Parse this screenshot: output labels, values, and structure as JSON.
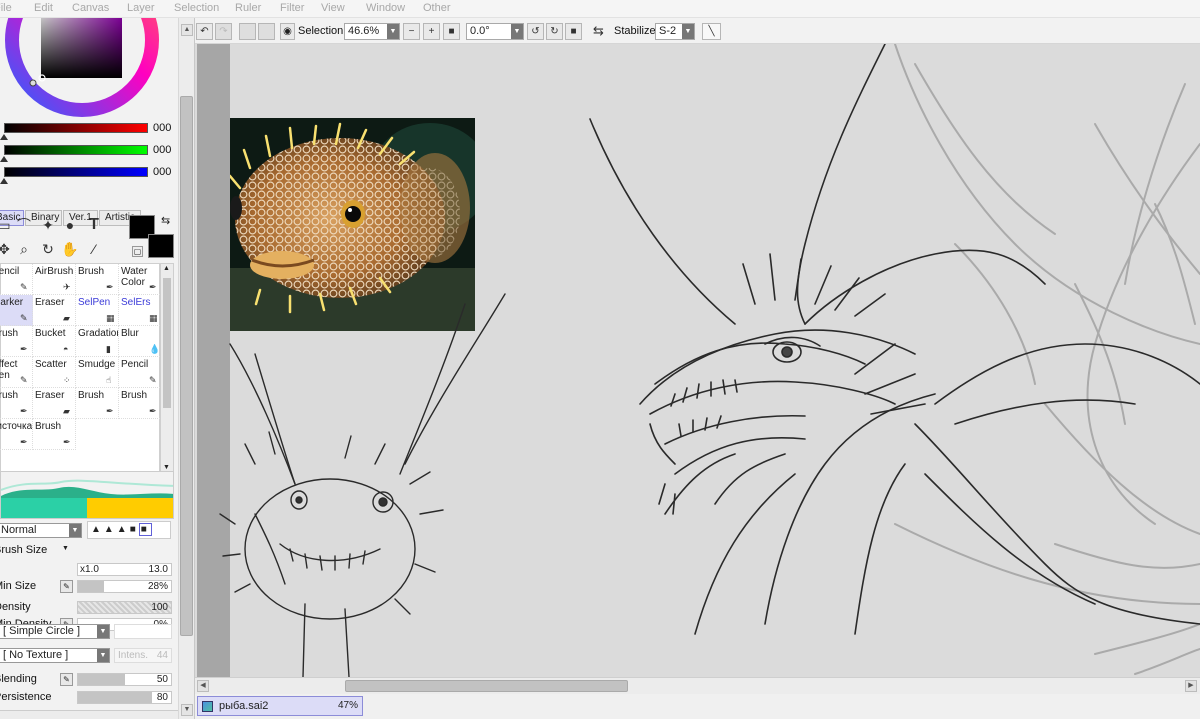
{
  "menu": [
    "File",
    "Edit",
    "Canvas",
    "Layer",
    "Selection",
    "Ruler",
    "Filter",
    "View",
    "Window",
    "Other"
  ],
  "color_sliders": {
    "red_value": "000",
    "green_value": "000",
    "blue_value": "000"
  },
  "mode_tabs": [
    "Basic",
    "Binary",
    "Ver.1",
    "Artistic"
  ],
  "brushes": [
    {
      "label": "Pencil",
      "icon": "pencil-icon"
    },
    {
      "label": "AirBrush",
      "icon": "airbrush-icon"
    },
    {
      "label": "Brush",
      "icon": "brush-icon"
    },
    {
      "label": "Water Color",
      "icon": "watercolor-icon"
    },
    {
      "label": "Marker",
      "icon": "marker-icon"
    },
    {
      "label": "Eraser",
      "icon": "eraser-icon"
    },
    {
      "label": "SelPen",
      "icon": "selpen-icon"
    },
    {
      "label": "SelErs",
      "icon": "selers-icon"
    },
    {
      "label": "Brush",
      "icon": "brush-icon"
    },
    {
      "label": "Bucket",
      "icon": "bucket-icon"
    },
    {
      "label": "Gradation",
      "icon": "gradation-icon"
    },
    {
      "label": "Blur",
      "icon": "blur-icon"
    },
    {
      "label": "Effect Pen",
      "icon": "effect-pen-icon"
    },
    {
      "label": "Scatter",
      "icon": "scatter-icon"
    },
    {
      "label": "Smudge",
      "icon": "smudge-icon"
    },
    {
      "label": "Pencil",
      "icon": "pencil-icon"
    },
    {
      "label": "Brush",
      "icon": "brush-icon"
    },
    {
      "label": "Eraser",
      "icon": "eraser-icon"
    },
    {
      "label": "Brush",
      "icon": "brush-icon"
    },
    {
      "label": "Brush",
      "icon": "brush-icon"
    },
    {
      "label": "кисточка",
      "icon": "brush-icon"
    },
    {
      "label": "Brush",
      "icon": "brush-icon"
    }
  ],
  "brush_props": {
    "blend_mode": "Normal",
    "brush_size_label": "Brush Size",
    "brush_size_multiplier": "x1.0",
    "brush_size_value": "13.0",
    "min_size_label": "Min Size",
    "min_size_value": "28%",
    "min_size_fill": 0.28,
    "density_label": "Density",
    "density_value": "100",
    "min_density_label": "Min Density",
    "min_density_value": "0%",
    "shape": "[ Simple Circle ]",
    "texture": "[ No Texture ]",
    "texture_intensity_label": "Intens.",
    "texture_intensity_value": "44",
    "blending_label": "Blending",
    "blending_value": "50",
    "blending_fill": 0.5,
    "persistence_label": "Persistence",
    "persistence_value": "80",
    "persistence_fill": 0.8
  },
  "toolbar": {
    "selection_label": "Selection",
    "zoom": "46.6%",
    "rotation": "0.0°",
    "stabilizer_label": "Stabilizer",
    "stabilizer_value": "S-2"
  },
  "status": {
    "document_name": "рыба.sai2",
    "document_zoom": "47%"
  },
  "colors": {
    "selected_tab": "#dcdcf7",
    "accent_border": "#8c8cd8",
    "canvas_bg": "#dbdbdb",
    "swatch_primary": "#000000",
    "bar_yellow": "#ffcc00",
    "bar_teal": "#2bd0a6"
  }
}
